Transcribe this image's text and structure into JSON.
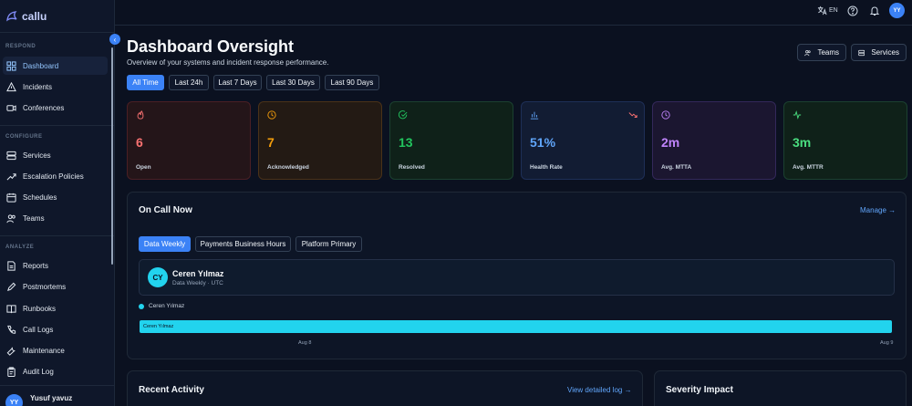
{
  "app": {
    "logo_text": "callu"
  },
  "topbar": {
    "lang": "EN",
    "user_initials": "YY"
  },
  "sidebar": {
    "sections": [
      "RESPOND",
      "CONFIGURE",
      "ANALYZE"
    ],
    "items": [
      {
        "label": "Dashboard"
      },
      {
        "label": "Incidents"
      },
      {
        "label": "Conferences"
      },
      {
        "label": "Services"
      },
      {
        "label": "Escalation Policies"
      },
      {
        "label": "Schedules"
      },
      {
        "label": "Teams"
      },
      {
        "label": "Reports"
      },
      {
        "label": "Postmortems"
      },
      {
        "label": "Runbooks"
      },
      {
        "label": "Call Logs"
      },
      {
        "label": "Maintenance"
      },
      {
        "label": "Audit Log"
      }
    ],
    "user": {
      "initials": "YY",
      "name": "Yusuf yavuz"
    }
  },
  "header": {
    "title": "Dashboard Oversight",
    "subtitle": "Overview of your systems and incident response performance.",
    "buttons": {
      "teams": "Teams",
      "services": "Services"
    }
  },
  "filters": [
    "All Time",
    "Last 24h",
    "Last 7 Days",
    "Last 30 Days",
    "Last 90 Days"
  ],
  "stats": [
    {
      "value": "6",
      "label": "Open",
      "color": "#f87171"
    },
    {
      "value": "7",
      "label": "Acknowledged",
      "color": "#f59e0b"
    },
    {
      "value": "13",
      "label": "Resolved",
      "color": "#22c55e"
    },
    {
      "value": "51%",
      "label": "Health Rate",
      "color": "#60a5fa"
    },
    {
      "value": "2m",
      "label": "Avg. MTTA",
      "color": "#c084fc"
    },
    {
      "value": "3m",
      "label": "Avg. MTTR",
      "color": "#4ade80"
    }
  ],
  "oncall": {
    "title": "On Call Now",
    "manage": "Manage →",
    "schedules": [
      "Data Weekly",
      "Payments Business Hours",
      "Platform Primary"
    ],
    "person": {
      "initials": "CY",
      "name": "Ceren Yılmaz",
      "detail": "Data Weekly · UTC"
    },
    "legend": "Ceren Yılmaz",
    "bar_label": "Ceren Yılmaz",
    "ticks": [
      "Aug 8",
      "Aug 9"
    ]
  },
  "recent": {
    "title": "Recent Activity",
    "link": "View detailed log →"
  },
  "severity": {
    "title": "Severity Impact"
  }
}
